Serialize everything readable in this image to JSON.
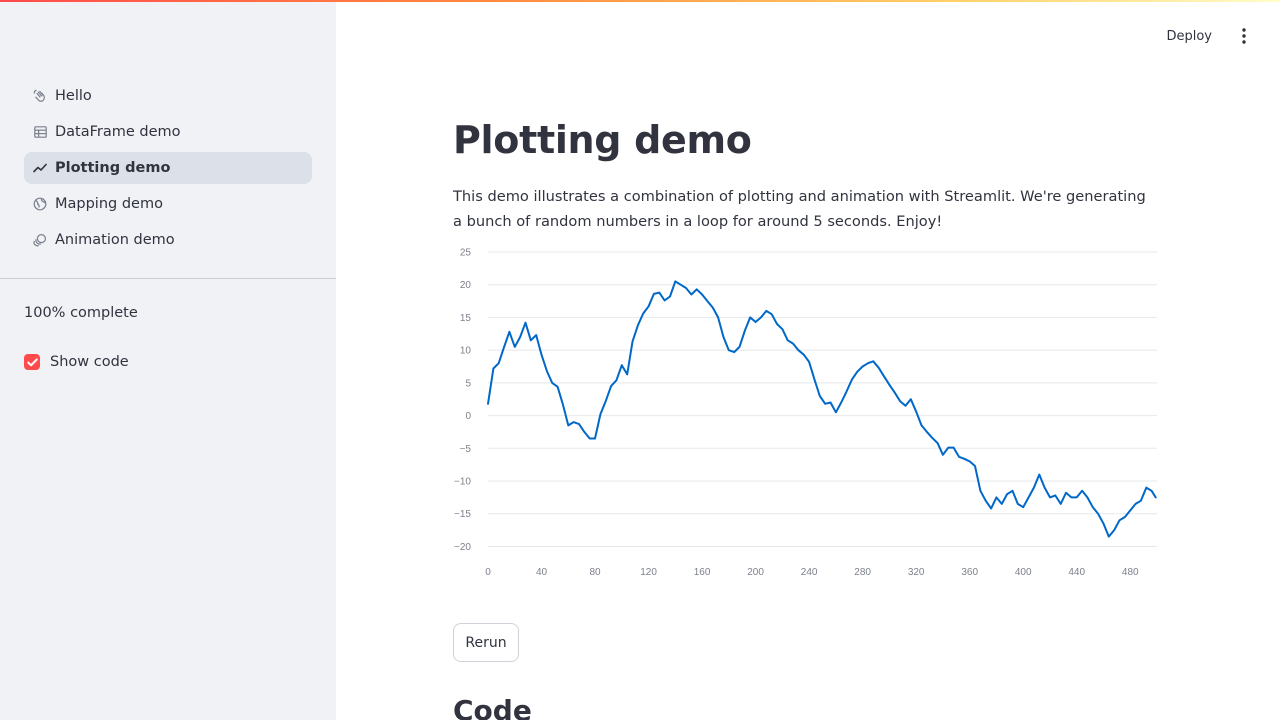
{
  "sidebar": {
    "nav_items": [
      {
        "label": "Hello",
        "icon": "waving-hand-icon",
        "active": false
      },
      {
        "label": "DataFrame demo",
        "icon": "table-icon",
        "active": false
      },
      {
        "label": "Plotting demo",
        "icon": "trending-line-icon",
        "active": true
      },
      {
        "label": "Mapping demo",
        "icon": "globe-icon",
        "active": false
      },
      {
        "label": "Animation demo",
        "icon": "animation-icon",
        "active": false
      }
    ],
    "progress_text": "100% complete",
    "show_code": {
      "label": "Show code",
      "checked": true
    }
  },
  "header": {
    "deploy_label": "Deploy",
    "menu_icon": "more-vertical-icon"
  },
  "main": {
    "title": "Plotting demo",
    "description": "This demo illustrates a combination of plotting and animation with Streamlit. We're generating a bunch of random numbers in a loop for around 5 seconds. Enjoy!",
    "rerun_label": "Rerun",
    "code_heading": "Code"
  },
  "colors": {
    "accent": "#ff4b4b",
    "line": "#0068c9",
    "sidebar_bg": "#f0f2f6",
    "active_nav_bg": "#dce0e8",
    "text": "#31333f"
  },
  "chart_data": {
    "type": "line",
    "title": "",
    "xlabel": "",
    "ylabel": "",
    "xlim": [
      0,
      500
    ],
    "ylim": [
      -21,
      25
    ],
    "x_ticks": [
      0,
      40,
      80,
      120,
      160,
      200,
      240,
      280,
      320,
      360,
      400,
      440,
      480
    ],
    "y_ticks": [
      25,
      20,
      15,
      10,
      5,
      0,
      -5,
      -10,
      -15,
      -20
    ],
    "grid": true,
    "series": [
      {
        "x": [
          0,
          4,
          8,
          12,
          16,
          20,
          24,
          28,
          32,
          36,
          40,
          44,
          48,
          52,
          56,
          60,
          64,
          68,
          72,
          76,
          80,
          84,
          88,
          92,
          96,
          100,
          104,
          108,
          112,
          116,
          120,
          124,
          128,
          132,
          136,
          140,
          144,
          148,
          152,
          156,
          160,
          164,
          168,
          172,
          176,
          180,
          184,
          188,
          192,
          196,
          200,
          204,
          208,
          212,
          216,
          220,
          224,
          228,
          232,
          236,
          240,
          244,
          248,
          252,
          256,
          260,
          264,
          268,
          272,
          276,
          280,
          284,
          288,
          292,
          296,
          300,
          304,
          308,
          312,
          316,
          320,
          324,
          328,
          332,
          336,
          340,
          344,
          348,
          352,
          356,
          360,
          364,
          368,
          372,
          376,
          380,
          384,
          388,
          392,
          396,
          400,
          404,
          408,
          412,
          416,
          420,
          424,
          428,
          432,
          436,
          440,
          444,
          448,
          452,
          456,
          460,
          464,
          468,
          472,
          476,
          480,
          484,
          488,
          492,
          496,
          499
        ],
        "y": [
          1.8,
          7.2,
          8.0,
          10.5,
          12.8,
          10.5,
          12.0,
          14.2,
          11.5,
          12.3,
          9.3,
          6.8,
          5.0,
          4.4,
          1.7,
          -1.5,
          -1.0,
          -1.3,
          -2.5,
          -3.5,
          -3.5,
          0.2,
          2.2,
          4.5,
          5.4,
          7.7,
          6.3,
          11.3,
          13.8,
          15.6,
          16.7,
          18.6,
          18.8,
          17.6,
          18.2,
          20.5,
          20.0,
          19.5,
          18.5,
          19.3,
          18.5,
          17.5,
          16.5,
          15.0,
          12.0,
          10.0,
          9.7,
          10.5,
          13.0,
          15.0,
          14.3,
          15.0,
          16.0,
          15.5,
          14.0,
          13.2,
          11.5,
          11.0,
          10.0,
          9.3,
          8.2,
          5.5,
          3.0,
          1.8,
          2.0,
          0.5,
          2.0,
          3.7,
          5.5,
          6.7,
          7.5,
          8.0,
          8.3,
          7.3,
          6.0,
          4.7,
          3.5,
          2.2,
          1.5,
          2.5,
          0.6,
          -1.5,
          -2.5,
          -3.4,
          -4.2,
          -6.0,
          -4.9,
          -4.9,
          -6.3,
          -6.6,
          -7.0,
          -7.7,
          -11.5,
          -13.0,
          -14.2,
          -12.5,
          -13.5,
          -12.0,
          -11.5,
          -13.5,
          -14.0,
          -12.5,
          -11.0,
          -9.0,
          -11.0,
          -12.5,
          -12.2,
          -13.5,
          -11.8,
          -12.5,
          -12.5,
          -11.5,
          -12.5,
          -14.0,
          -15.0,
          -16.5,
          -18.5,
          -17.5,
          -16.0,
          -15.5,
          -14.5,
          -13.5,
          -13.0,
          -11.0,
          -11.5,
          -12.5
        ]
      }
    ]
  }
}
